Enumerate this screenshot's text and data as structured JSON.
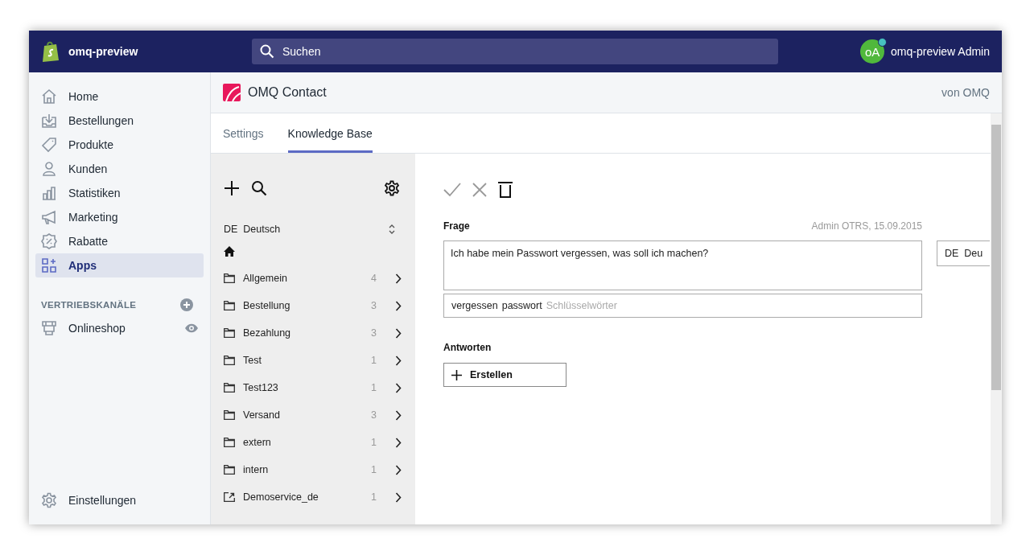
{
  "topbar": {
    "store_name": "omq-preview",
    "search": {
      "placeholder": "Suchen"
    },
    "user": {
      "initials": "oA",
      "name": "omq-preview Admin"
    }
  },
  "sidebar": {
    "items": [
      {
        "label": "Home",
        "selected": false
      },
      {
        "label": "Bestellungen",
        "selected": false
      },
      {
        "label": "Produkte",
        "selected": false
      },
      {
        "label": "Kunden",
        "selected": false
      },
      {
        "label": "Statistiken",
        "selected": false
      },
      {
        "label": "Marketing",
        "selected": false
      },
      {
        "label": "Rabatte",
        "selected": false
      },
      {
        "label": "Apps",
        "selected": true
      }
    ],
    "channels_heading": "VERTRIEBSKANÄLE",
    "channels": [
      {
        "label": "Onlineshop"
      }
    ],
    "settings": "Einstellungen"
  },
  "app_header": {
    "title": "OMQ Contact",
    "vendor": "von OMQ"
  },
  "tabs": [
    {
      "label": "Settings",
      "selected": false
    },
    {
      "label": "Knowledge Base",
      "selected": true
    }
  ],
  "categories": {
    "language": {
      "code": "DE",
      "name": "Deutsch"
    },
    "items": [
      {
        "label": "Allgemein",
        "count": "4",
        "kind": "folder"
      },
      {
        "label": "Bestellung",
        "count": "3",
        "kind": "folder"
      },
      {
        "label": "Bezahlung",
        "count": "3",
        "kind": "folder"
      },
      {
        "label": "Test",
        "count": "1",
        "kind": "folder"
      },
      {
        "label": "Test123",
        "count": "1",
        "kind": "folder"
      },
      {
        "label": "Versand",
        "count": "3",
        "kind": "folder"
      },
      {
        "label": "extern",
        "count": "1",
        "kind": "folder"
      },
      {
        "label": "intern",
        "count": "1",
        "kind": "folder"
      },
      {
        "label": "Demoservice_de",
        "count": "1",
        "kind": "link"
      }
    ]
  },
  "editor": {
    "question_label": "Frage",
    "author": "Admin OTRS, 15.09.2015",
    "question": "Ich habe mein Passwort vergessen, was soll ich machen?",
    "keywords": [
      "vergessen",
      "passwort"
    ],
    "keywords_placeholder": "Schlüsselwörter",
    "language": {
      "code": "DE",
      "name": "Deu"
    },
    "answers_label": "Antworten",
    "create_button": "Erstellen"
  }
}
